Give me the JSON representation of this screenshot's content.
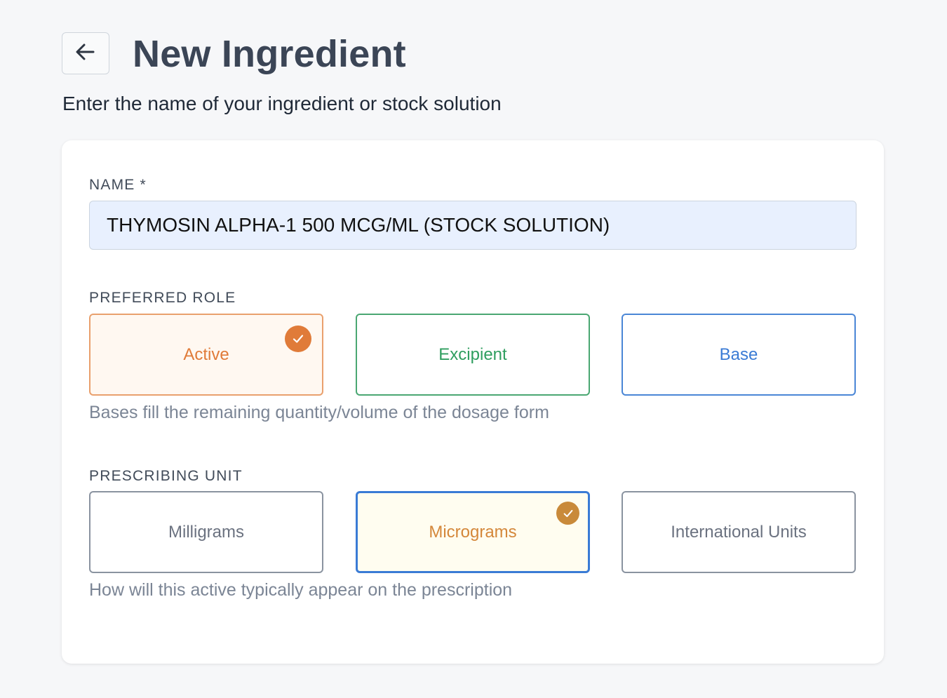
{
  "header": {
    "title": "New Ingredient",
    "subtitle": "Enter the name of your ingredient or stock solution",
    "back_icon": "arrow-left-icon"
  },
  "form": {
    "name": {
      "label": "NAME *",
      "value": "THYMOSIN ALPHA-1 500 MCG/ML (STOCK SOLUTION)"
    },
    "role": {
      "label": "PREFERRED ROLE",
      "options": [
        {
          "label": "Active",
          "selected": true,
          "color": "#e07b39",
          "bg": "#fff8f1"
        },
        {
          "label": "Excipient",
          "selected": false,
          "color": "#2f9e5f",
          "bg": "#ffffff"
        },
        {
          "label": "Base",
          "selected": false,
          "color": "#3a7bd5",
          "bg": "#ffffff"
        }
      ],
      "hint": "Bases fill the remaining quantity/volume of the dosage form"
    },
    "unit": {
      "label": "PRESCRIBING UNIT",
      "options": [
        {
          "label": "Milligrams",
          "selected": false,
          "color": "#6b7280"
        },
        {
          "label": "Micrograms",
          "selected": true,
          "color": "#d4873a",
          "border": "#3a7bd5",
          "bg": "#fffdf0"
        },
        {
          "label": "International Units",
          "selected": false,
          "color": "#6b7280"
        }
      ],
      "hint": "How will this active typically appear on the prescription"
    }
  },
  "colors": {
    "check_orange": "#e07b39",
    "check_amber": "#c98a3a",
    "title": "#3b4556"
  }
}
